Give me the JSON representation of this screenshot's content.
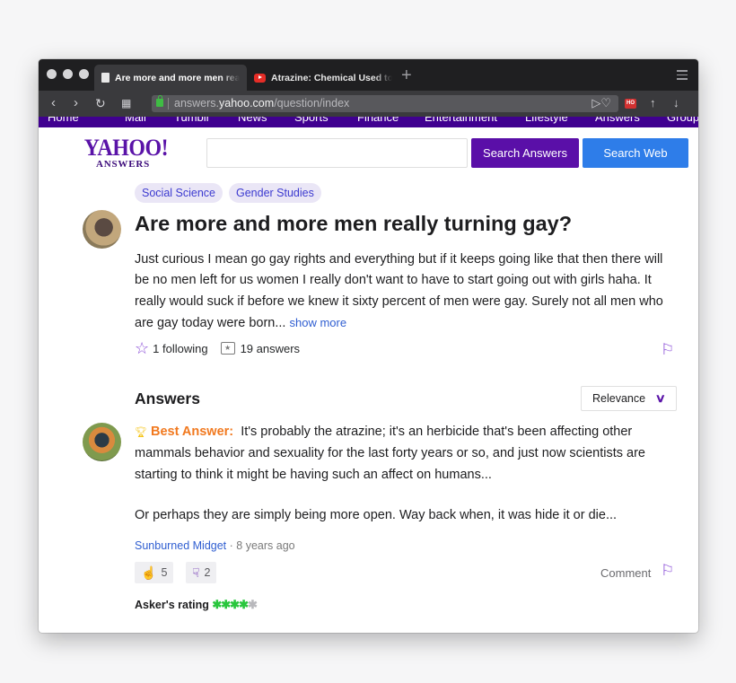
{
  "browser": {
    "tabs": [
      {
        "title": "Are more and more men really turning gay?",
        "active": true
      },
      {
        "title": "Atrazine: Chemical Used to Control Weeds",
        "active": false
      }
    ],
    "url_prefix": "answers.",
    "url_domain": "yahoo.com",
    "url_path": "/question/index",
    "extension_badge": "HO"
  },
  "yahoo_nav": [
    "Home",
    "Mail",
    "Tumblr",
    "News",
    "Sports",
    "Finance",
    "Entertainment",
    "Lifestyle",
    "Answers",
    "Groups"
  ],
  "header": {
    "logo_main": "YAHOO!",
    "logo_sub": "ANSWERS",
    "search_placeholder": "",
    "search_answers_label": "Search Answers",
    "search_web_label": "Search Web"
  },
  "question": {
    "categories": [
      "Social Science",
      "Gender Studies"
    ],
    "title": "Are more and more men really turning gay?",
    "body": "Just curious I mean go gay rights and everything but if it keeps going like that then there will be no men left for us women I really don't want to have to start going out with girls haha. It really would suck if before we knew it sixty percent of men were gay. Surely not all men who are gay today were born...",
    "show_more": "show more",
    "following": "1 following",
    "answers_count": "19 answers"
  },
  "answers_section": {
    "heading": "Answers",
    "sort_label": "Relevance"
  },
  "best_answer": {
    "label": "Best Answer:",
    "text": "It's probably the atrazine; it's an herbicide that's been affecting other mammals behavior and sexuality for the last forty years or so, and just now scientists are starting to think it might be having such an affect on humans...",
    "text2": "Or perhaps they are simply being more open. Way back when, it was hide it or die...",
    "author": "Sunburned Midget",
    "age": "· 8 years ago",
    "thumbs_up": "5",
    "thumbs_down": "2",
    "comment_label": "Comment",
    "asker_rating_label": "Asker's rating",
    "asker_rating_stars": 4,
    "asker_rating_max": 5
  },
  "colors": {
    "yahoo_purple": "#400090",
    "search_answers_bg": "#5a0fa8",
    "search_web_bg": "#2e7de9",
    "best_answer": "#f1791f",
    "link_blue": "#2f5ed1",
    "rating_green": "#29c63d"
  }
}
